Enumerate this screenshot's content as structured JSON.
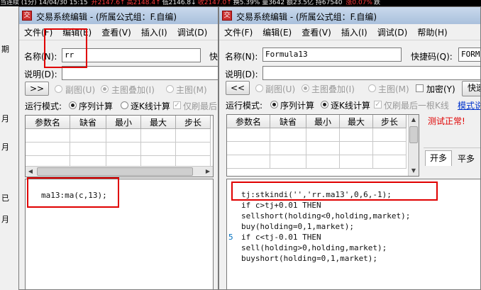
{
  "ticker": [
    {
      "text": "当连续 (1分) 14/04/30 15:15 ",
      "color": "white"
    },
    {
      "text": "开2147.6↑",
      "color": "red"
    },
    {
      "text": "高2148.4↑",
      "color": "red"
    },
    {
      "text": "低2146.8↓",
      "color": "white"
    },
    {
      "text": "收2147.0↑",
      "color": "red"
    },
    {
      "text": "换5.39% 量3642 额23.5亿 持67540 ",
      "color": "white"
    },
    {
      "text": "涨0.07%",
      "color": "red"
    },
    {
      "text": "跌",
      "color": "white"
    }
  ],
  "left_strip": [
    "期",
    "月",
    "月",
    "已",
    "月"
  ],
  "left_window": {
    "title": "交易系统编辑 - (所属公式组：F.自编)",
    "menu": [
      "文件(F)",
      "编辑(E)",
      "查看(V)",
      "插入(I)",
      "调试(D)",
      "帮"
    ],
    "name_label": "名称(N):",
    "name_value": "rr",
    "shortcut_label": "快",
    "desc_label": "说明(D):",
    "desc_value": "",
    "expand_button": ">>",
    "radio_options": [
      "副图(U)",
      "主图叠加(I)",
      "主图(M)"
    ],
    "run_mode_label": "运行模式:",
    "run_mode_options": [
      "序列计算",
      "逐K线计算",
      "仅刷最后"
    ],
    "grid_headers": [
      "参数名",
      "缺省",
      "最小",
      "最大",
      "步长"
    ],
    "code_lines": [
      "ma13:ma(c,13);"
    ]
  },
  "right_window": {
    "title": "交易系统编辑 - (所属公式组：F.自编)",
    "menu": [
      "文件(F)",
      "编辑(E)",
      "查看(V)",
      "插入(I)",
      "调试(D)",
      "帮助(H)"
    ],
    "name_label": "名称(N):",
    "name_value": "Formula13",
    "shortcut_label": "快捷码(Q):",
    "shortcut_value": "FORMU",
    "desc_label": "说明(D):",
    "desc_value": "",
    "collapse_button": "<<",
    "radio_options": [
      "副图(U)",
      "主图叠加(I)",
      "主图(M)"
    ],
    "encrypt_label": "加密(Y)",
    "quick_button": "快速",
    "run_mode_label": "运行模式:",
    "run_mode_options": [
      "序列计算",
      "逐K线计算",
      "仅刷最后一根K线"
    ],
    "mode_link": "模式说",
    "grid_headers": [
      "参数名",
      "缺省",
      "最小",
      "最大",
      "步长"
    ],
    "test_status": "测试正常!",
    "tabs": [
      "开多",
      "平多"
    ],
    "line_number": "5",
    "code_lines": [
      "tj:stkindi('','rr.ma13',0,6,-1);",
      "if c>tj+0.01 THEN",
      "sellshort(holding<0,holding,market);",
      "buy(holding=0,1,market);",
      "if c<tj-0.01 THEN",
      "sell(holding>0,holding,market);",
      "buyshort(holding=0,1,market);"
    ]
  },
  "colors": {
    "highlight": "#e00000",
    "status_red": "#e00000",
    "link_blue": "#0033cc"
  }
}
